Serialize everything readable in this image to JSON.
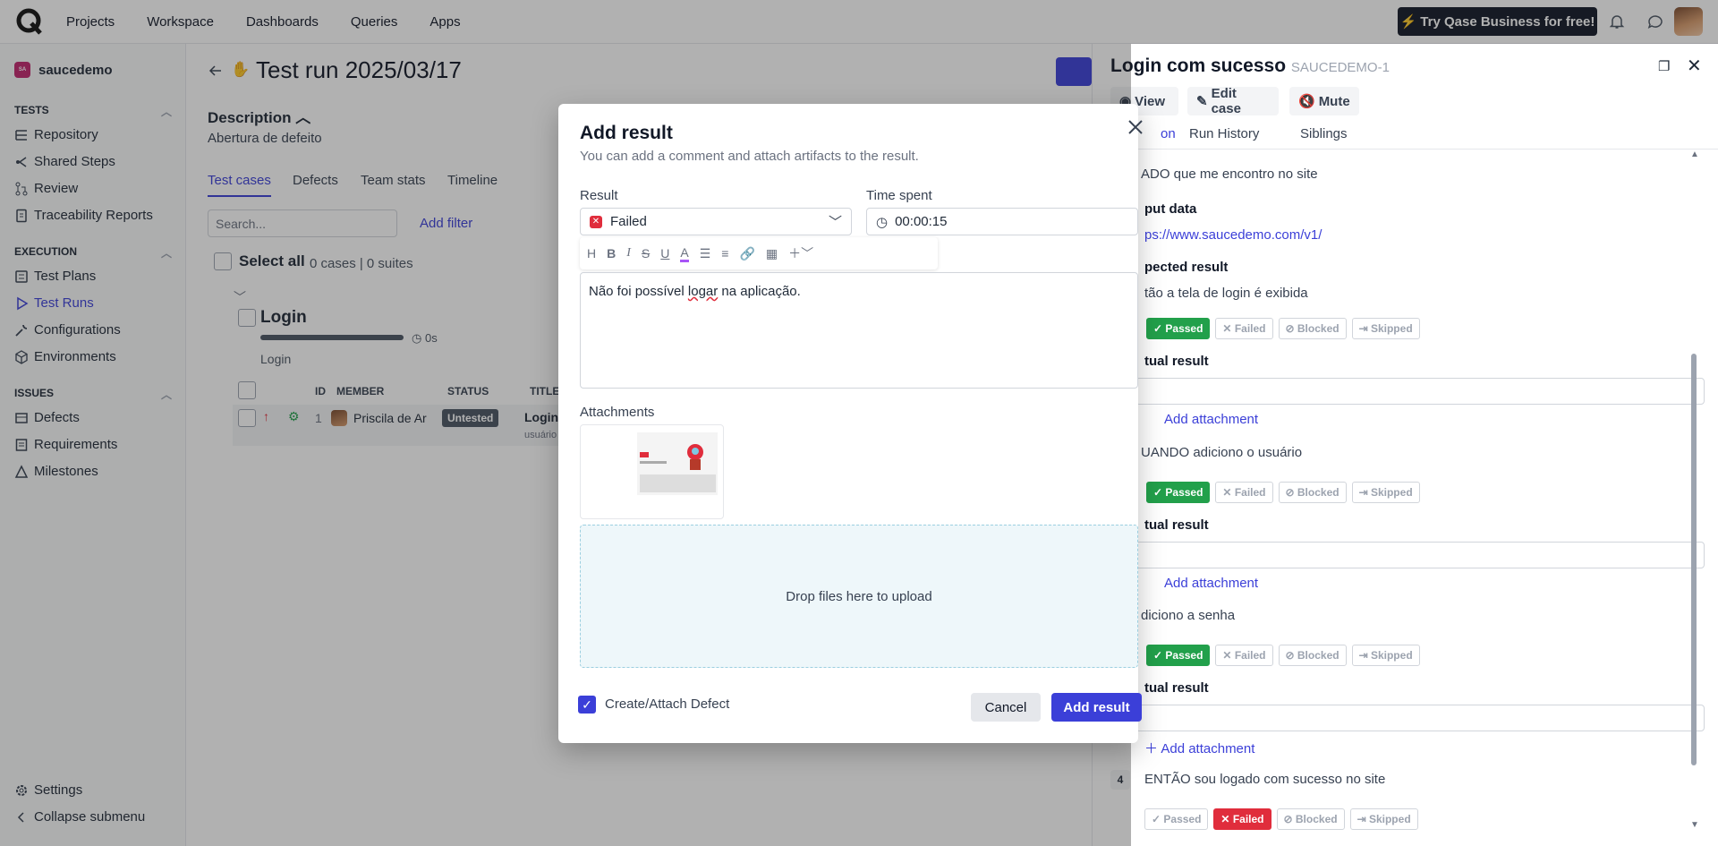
{
  "topbar": {
    "nav": [
      "Projects",
      "Workspace",
      "Dashboards",
      "Queries",
      "Apps"
    ],
    "cta": "Try Qase Business for free!"
  },
  "sidebar": {
    "project": "saucedemo",
    "project_badge": "SA",
    "sections": {
      "tests": "TESTS",
      "execution": "EXECUTION",
      "issues": "ISSUES"
    },
    "tests_items": [
      "Repository",
      "Shared Steps",
      "Review",
      "Traceability Reports"
    ],
    "execution_items": [
      "Test Plans",
      "Test Runs",
      "Configurations",
      "Environments"
    ],
    "issues_items": [
      "Defects",
      "Requirements",
      "Milestones"
    ],
    "settings": "Settings",
    "collapse": "Collapse submenu"
  },
  "main": {
    "title": "Test run 2025/03/17",
    "description_heading": "Description",
    "description": "Abertura de defeito",
    "tabs": [
      "Test cases",
      "Defects",
      "Team stats",
      "Timeline"
    ],
    "search_placeholder": "Search...",
    "add_filter": "Add filter",
    "select_all": "Select all",
    "select_count": "0 cases | 0 suites",
    "suite_title": "Login",
    "suite_time": "0s",
    "suite_sub": "Login",
    "columns": [
      "ID",
      "MEMBER",
      "STATUS",
      "TITLE"
    ],
    "row": {
      "id": "1",
      "member": "Priscila de Ar",
      "status": "Untested",
      "title": "Login",
      "title_sub": "usuário"
    }
  },
  "panel": {
    "title": "Login com sucesso",
    "case_id": "SAUCEDEMO-1",
    "buttons": [
      "View",
      "Edit case",
      "Mute"
    ],
    "tabs": [
      "on",
      "Run History",
      "Siblings"
    ],
    "step1_text": "ADO que me encontro no site",
    "input_data_label": "put data",
    "input_data_link": "ps://www.saucedemo.com/v1/",
    "expected_label": "pected result",
    "expected_text": "tão a tela de login é exibida",
    "actual_label": "tual result",
    "add_attachment": "Add attachment",
    "step2_text": "UANDO adiciono o usuário",
    "step3_text": "diciono a senha",
    "step4_num": "4",
    "step4_text": "ENTÃO sou logado com sucesso no site",
    "status_labels": [
      "Passed",
      "Failed",
      "Blocked",
      "Skipped"
    ]
  },
  "modal": {
    "title": "Add result",
    "subtitle": "You can add a comment and attach artifacts to the result.",
    "result_label": "Result",
    "result_value": "Failed",
    "time_label": "Time spent",
    "time_value": "00:00:15",
    "comment_pre": "Não foi possível ",
    "comment_err": "logar",
    "comment_post": " na aplicação.",
    "attachments_label": "Attachments",
    "drop_text": "Drop files here to upload",
    "defect_label": "Create/Attach Defect",
    "cancel": "Cancel",
    "submit": "Add result"
  },
  "colors": {
    "accent": "#3b3fd8",
    "passed": "#22a04b",
    "failed": "#e02d3c"
  }
}
